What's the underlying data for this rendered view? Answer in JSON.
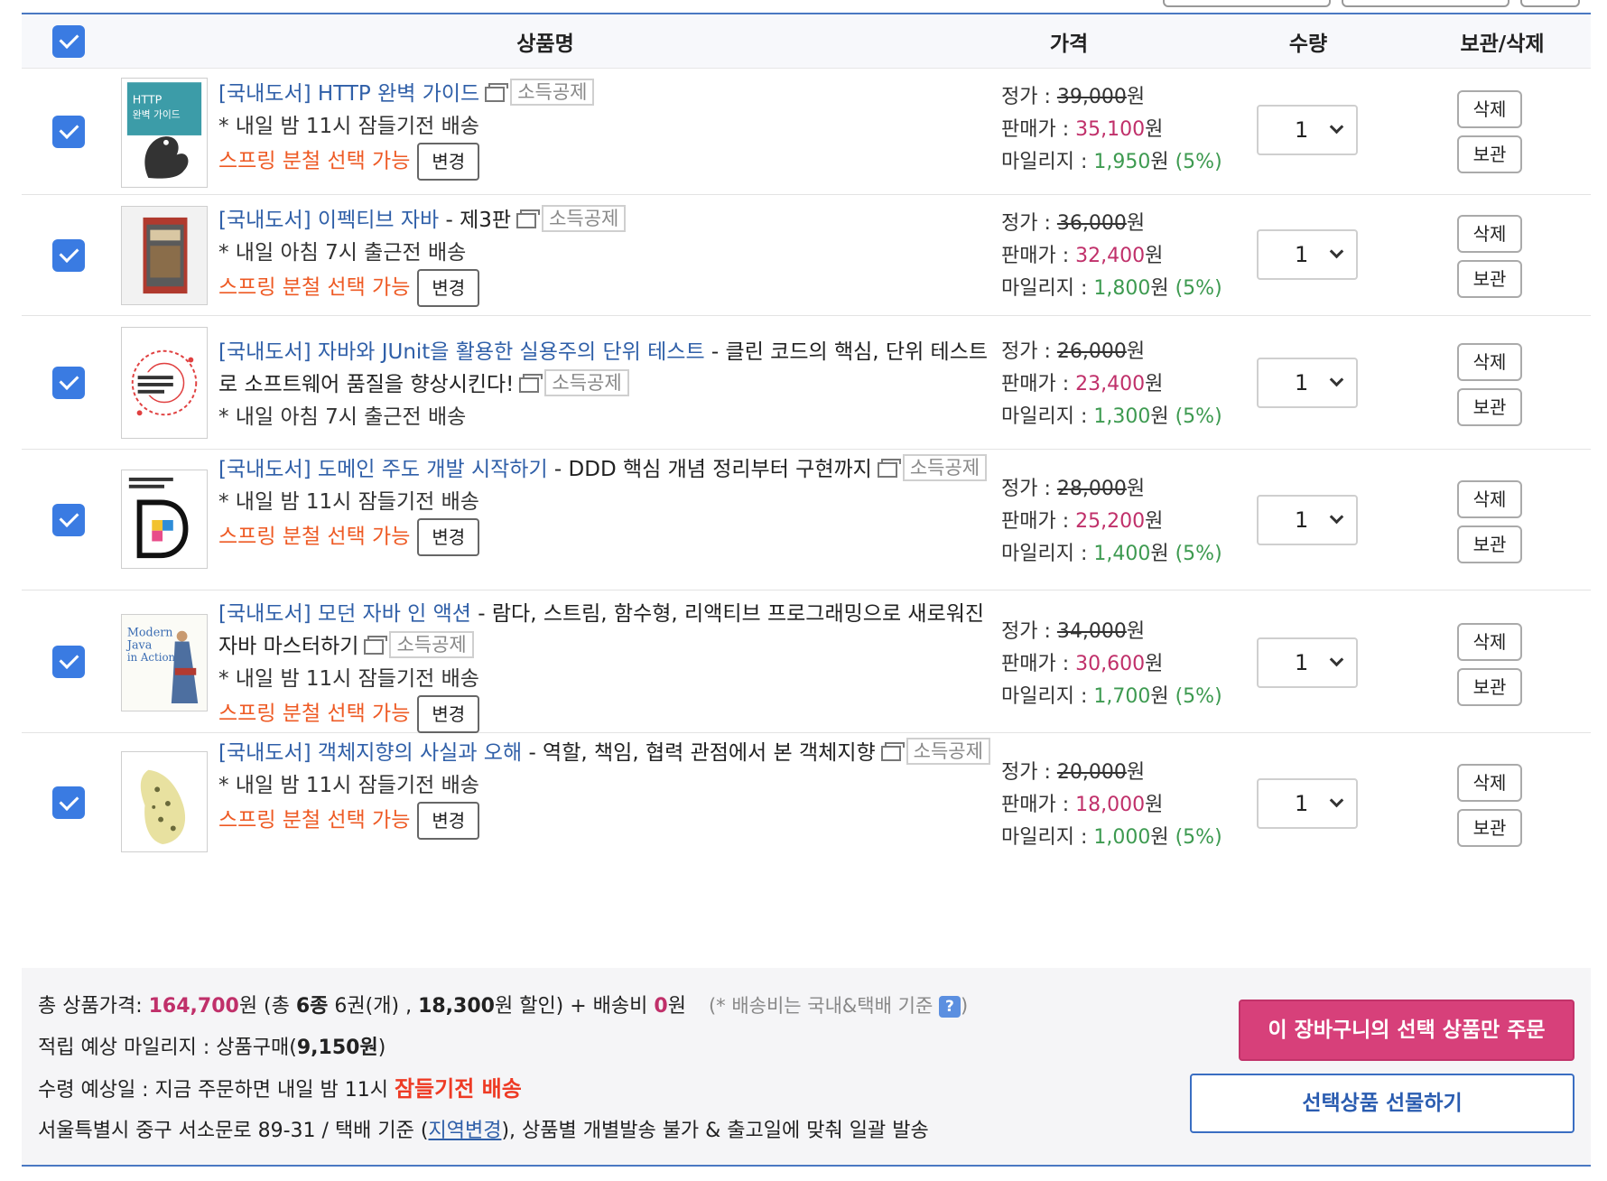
{
  "header": {
    "col_product": "상품명",
    "col_price": "가격",
    "col_qty": "수량",
    "col_action": "보관/삭제"
  },
  "labels": {
    "list_price": "정가 : ",
    "sale_price": "판매가 : ",
    "mileage": "마일리지 : ",
    "won": "원",
    "tax_tag": "소득공제",
    "change": "변경",
    "delete": "삭제",
    "keep": "보관"
  },
  "items": [
    {
      "category": "[국내도서]",
      "title": "HTTP 완벽 가이드",
      "subtitle": "",
      "shipping": "* 내일 밤 11시 잠들기전 배송",
      "split": "스프링 분철 선택 가능",
      "list_price": "39,000",
      "sale_price": "35,100",
      "mileage": "1,950",
      "mileage_rate": "(5%)",
      "qty": "1"
    },
    {
      "category": "[국내도서]",
      "title": "이펙티브 자바",
      "subtitle": " - 제3판",
      "shipping": "* 내일 아침 7시 출근전 배송",
      "split": "스프링 분철 선택 가능",
      "list_price": "36,000",
      "sale_price": "32,400",
      "mileage": "1,800",
      "mileage_rate": "(5%)",
      "qty": "1"
    },
    {
      "category": "[국내도서]",
      "title": "자바와 JUnit을 활용한 실용주의 단위 테스트",
      "subtitle": " - 클린 코드의 핵심, 단위 테스트로 소프트웨어 품질을 향상시킨다!",
      "shipping": "* 내일 아침 7시 출근전 배송",
      "split": "",
      "list_price": "26,000",
      "sale_price": "23,400",
      "mileage": "1,300",
      "mileage_rate": "(5%)",
      "qty": "1"
    },
    {
      "category": "[국내도서]",
      "title": "도메인 주도 개발 시작하기",
      "subtitle": " - DDD 핵심 개념 정리부터 구현까지",
      "shipping": "* 내일 밤 11시 잠들기전 배송",
      "split": "스프링 분철 선택 가능",
      "list_price": "28,000",
      "sale_price": "25,200",
      "mileage": "1,400",
      "mileage_rate": "(5%)",
      "qty": "1"
    },
    {
      "category": "[국내도서]",
      "title": "모던 자바 인 액션",
      "subtitle": " - 람다, 스트림, 함수형, 리액티브 프로그래밍으로 새로워진 자바 마스터하기",
      "shipping": "* 내일 밤 11시 잠들기전 배송",
      "split": "스프링 분철 선택 가능",
      "list_price": "34,000",
      "sale_price": "30,600",
      "mileage": "1,700",
      "mileage_rate": "(5%)",
      "qty": "1"
    },
    {
      "category": "[국내도서]",
      "title": "객체지향의 사실과 오해",
      "subtitle": " - 역할, 책임, 협력 관점에서 본 객체지향",
      "shipping": "* 내일 밤 11시 잠들기전 배송",
      "split": "스프링 분철 선택 가능",
      "list_price": "20,000",
      "sale_price": "18,000",
      "mileage": "1,000",
      "mileage_rate": "(5%)",
      "qty": "1"
    }
  ],
  "covers": {
    "c1_text": "HTTP 완벽 가이드",
    "c5_text": "Modern Java in Action"
  },
  "summary": {
    "total_label": "총 상품가격: ",
    "total_value": "164,700",
    "won": "원",
    "count_open": " (총 ",
    "kinds": "6종",
    "count_rest": " 6권(개) , ",
    "discount": "18,300",
    "discount_suffix": "원 할인) + 배송비 ",
    "shipping_fee": "0",
    "shipping_note": "(* 배송비는 국내&택배 기준",
    "shipping_note_close": ")",
    "help": "?",
    "mileage_label": "적립 예상 마일리지 : 상품구매(",
    "mileage_value": "9,150원",
    "mileage_close": ")",
    "eta_label": "수령 예상일 : 지금 주문하면 내일 밤 11시 ",
    "eta_highlight": "잠들기전 배송",
    "addr_prefix": "서울특별시 중구 서소문로 89-31 / 택배 기준 (",
    "addr_link": "지역변경",
    "addr_suffix": "), 상품별 개별발송 불가 & 출고일에 맞춰 일괄 발송",
    "order_button": "이 장바구니의 선택 상품만 주문",
    "gift_button": "선택상품 선물하기"
  }
}
